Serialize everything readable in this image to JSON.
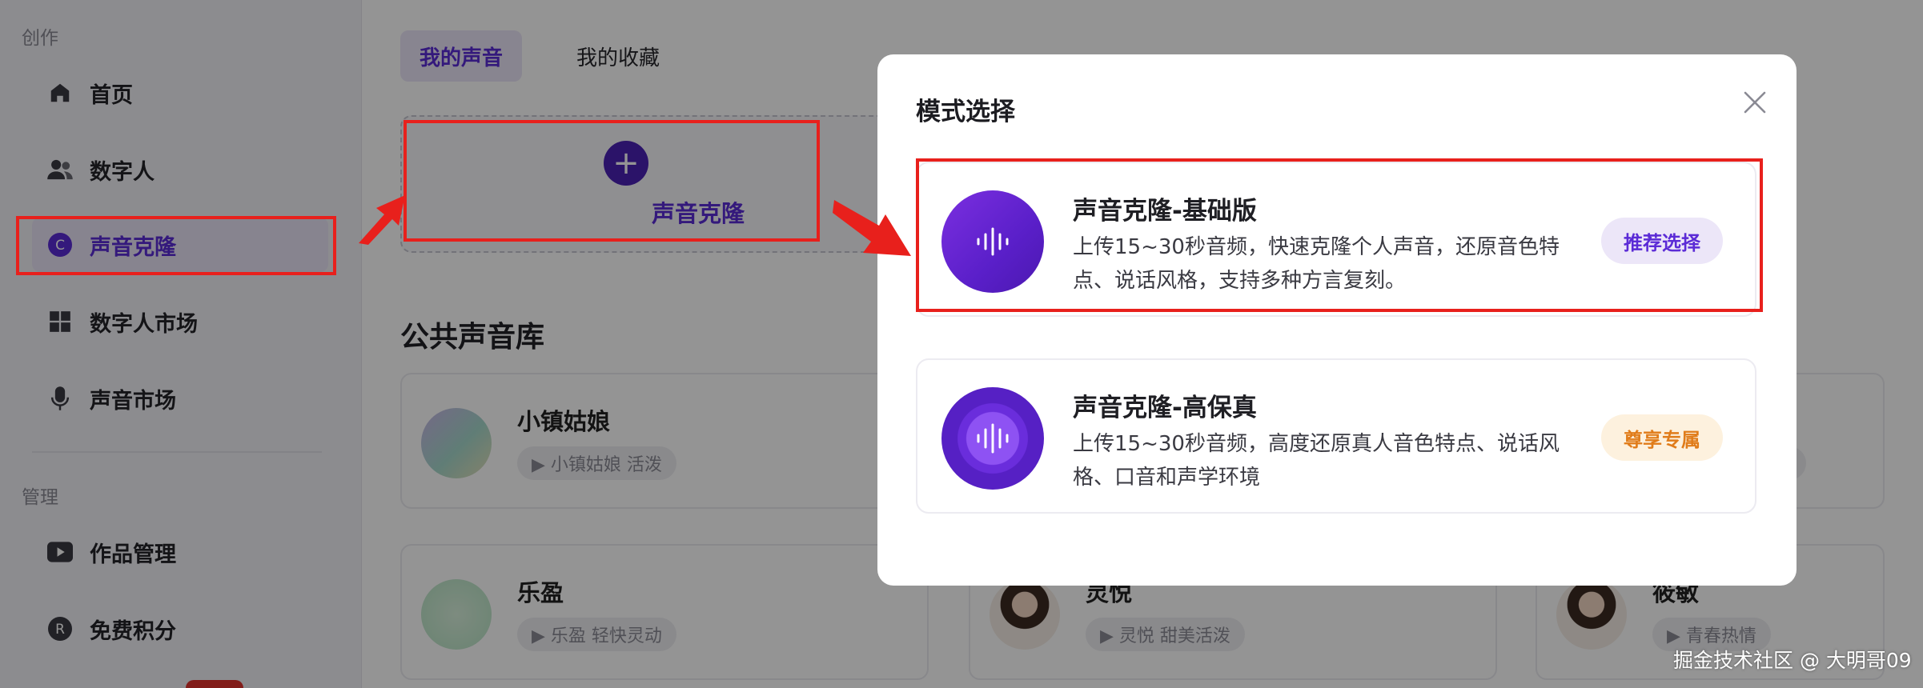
{
  "sidebar": {
    "section_create": "创作",
    "section_manage": "管理",
    "items": [
      {
        "label": "首页",
        "icon": "home-icon"
      },
      {
        "label": "数字人",
        "icon": "users-icon"
      },
      {
        "label": "声音克隆",
        "icon": "c-circle-icon",
        "active": true
      },
      {
        "label": "数字人市场",
        "icon": "grid-icon"
      },
      {
        "label": "声音市场",
        "icon": "microphone-icon"
      },
      {
        "label": "作品管理",
        "icon": "play-icon"
      },
      {
        "label": "免费积分",
        "icon": "r-circle-icon"
      }
    ],
    "c_glyph": "C",
    "r_glyph": "R"
  },
  "main": {
    "tabs": [
      {
        "label": "我的声音",
        "active": true
      },
      {
        "label": "我的收藏",
        "active": false
      }
    ],
    "clone_card": {
      "plus": "+",
      "label": "声音克隆"
    },
    "library_title": "公共声音库",
    "voices": [
      {
        "name": "小镇姑娘",
        "tag": "▶ 小镇姑娘 活泼"
      },
      {
        "name": "乐盈",
        "tag": "▶ 乐盈 轻快灵动"
      },
      {
        "name": "灵悦",
        "tag": "▶ 灵悦 甜美活泼"
      },
      {
        "name": "筱敏",
        "tag": "▶ 青春热情"
      }
    ]
  },
  "modal": {
    "title": "模式选择",
    "options": [
      {
        "title": "声音克隆-基础版",
        "desc": "上传15~30秒音频，快速克隆个人声音，还原音色特点、说话风格，支持多种方言复刻。",
        "tag": "推荐选择"
      },
      {
        "title": "声音克隆-高保真",
        "desc": "上传15~30秒音频，高度还原真人音色特点、说话风格、口音和声学环境",
        "tag": "尊享专属"
      }
    ]
  },
  "colors": {
    "accent": "#5b2bd6",
    "annotation_red": "#e8201c",
    "vip_orange": "#e07c1a"
  },
  "watermark": "掘金技术社区 @ 大明哥09"
}
